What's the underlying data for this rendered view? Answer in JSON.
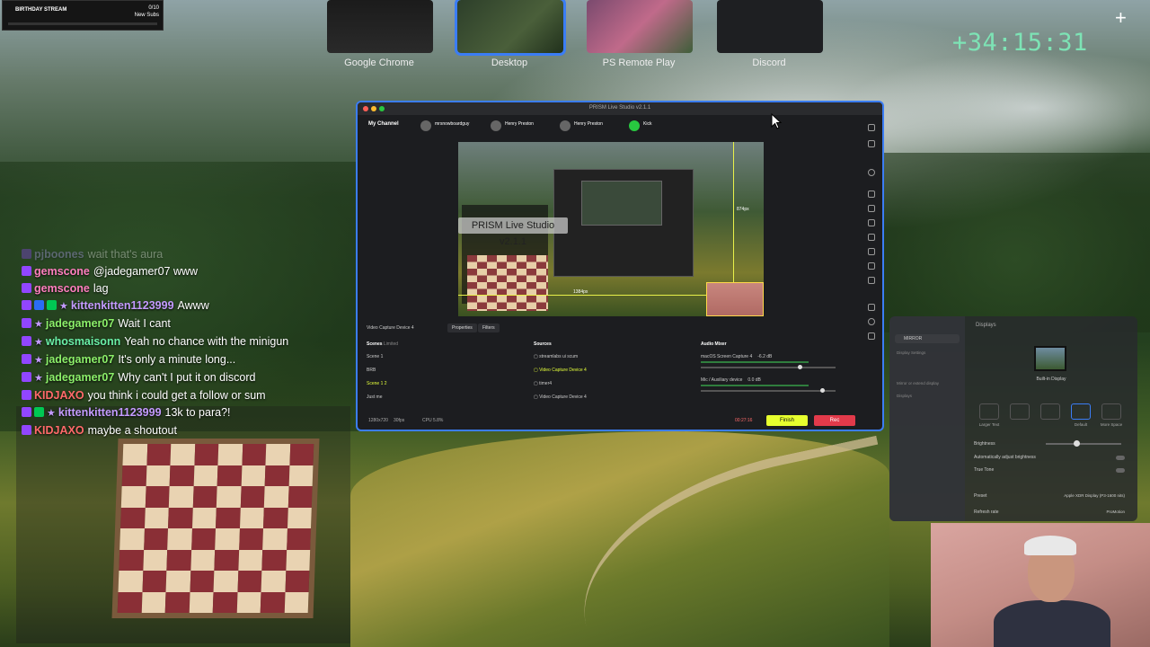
{
  "stream_widget": {
    "title": "BIRTHDAY STREAM",
    "count": "0/10",
    "subtitle": "New Subs"
  },
  "spaces": [
    {
      "label": "Google Chrome",
      "active": false
    },
    {
      "label": "Desktop",
      "active": true
    },
    {
      "label": "PS Remote Play",
      "active": false
    },
    {
      "label": "Discord",
      "active": false
    }
  ],
  "add_space_icon": "plus-icon",
  "timer": "+34:15:31",
  "chat": {
    "messages": [
      {
        "user": "pjboones",
        "text": "wait that's aura",
        "user_color": "#b9a4ff",
        "faded": true,
        "badges": [
          "purple"
        ]
      },
      {
        "user": "gemscone",
        "text": "@jadegamer07 www",
        "user_color": "#ff7fbf",
        "badges": [
          "purple"
        ]
      },
      {
        "user": "gemscone",
        "text": "lag",
        "user_color": "#ff7fbf",
        "badges": [
          "purple"
        ]
      },
      {
        "user": "kittenkitten1123999",
        "text": "Awww",
        "user_color": "#c49bff",
        "badges": [
          "purple",
          "blue",
          "green",
          "star"
        ]
      },
      {
        "user": "jadegamer07",
        "text": "Wait I cant",
        "user_color": "#8cf06a",
        "badges": [
          "purple",
          "star"
        ]
      },
      {
        "user": "whosmaisonn",
        "text": "Yeah no chance with the minigun",
        "user_color": "#6af0a8",
        "badges": [
          "purple",
          "star"
        ]
      },
      {
        "user": "jadegamer07",
        "text": "It's only a minute long...",
        "user_color": "#8cf06a",
        "badges": [
          "purple",
          "star"
        ]
      },
      {
        "user": "jadegamer07",
        "text": "Why can't I put it on discord",
        "user_color": "#8cf06a",
        "badges": [
          "purple",
          "star"
        ]
      },
      {
        "user": "KIDJAXO",
        "text": "you think i could get a follow or sum",
        "user_color": "#ff6a6a",
        "badges": [
          "purple"
        ]
      },
      {
        "user": "kittenkitten1123999",
        "text": "13k to para?!",
        "user_color": "#c49bff",
        "badges": [
          "purple",
          "green",
          "star"
        ]
      },
      {
        "user": "KIDJAXO",
        "text": "maybe a shoutout",
        "user_color": "#ff6a6a",
        "badges": [
          "purple"
        ]
      }
    ]
  },
  "prism": {
    "window_title": "PRISM Live Studio v2.1.1",
    "my_channel": "My Channel",
    "accounts": [
      {
        "name": "mrsnowboardguy"
      },
      {
        "name": "Henry Preston"
      },
      {
        "name": "Henry Preston"
      },
      {
        "name": "Kick"
      }
    ],
    "banner": "PRISM Live Studio v2.1.1",
    "preview_labels": {
      "width_px": "1384px",
      "height_px": "874px"
    },
    "source_label": "Video Capture Device 4",
    "tabs": [
      "Properties",
      "Filters"
    ],
    "scenes": {
      "title": "Scenes",
      "limit": "Limited",
      "items": [
        "Scene 1",
        "BRB",
        "Scene 1 2",
        "Just me"
      ],
      "selected": 2
    },
    "sources": {
      "title": "Sources",
      "items": [
        "streamlabs ui scum",
        "Video Capture Device 4",
        "timer4",
        "Video Capture Device 4"
      ],
      "selected": 1
    },
    "audio_mixer": {
      "title": "Audio Mixer",
      "channels": [
        {
          "name": "macOS Screen Capture 4",
          "db": "-6.2 dB",
          "level": 0.73
        },
        {
          "name": "Mic / Auxiliary device",
          "db": "0.0 dB",
          "level": 0.9
        }
      ]
    },
    "status": {
      "resolution": "1280x720",
      "fps": "30fps",
      "cpu": "CPU 5.8%",
      "live_time": "00:27:16"
    },
    "finish_label": "Finish",
    "rec_label": "Rec"
  },
  "displays": {
    "title": "Displays",
    "search_value": "MIRROR",
    "sidebar_items": [
      "Display Settings",
      "Mirror or extend display",
      "Displays"
    ],
    "monitor_label": "Built-in Display",
    "resolution_options": [
      "Larger Text",
      "",
      "",
      "Default",
      "More Space"
    ],
    "brightness_label": "Brightness",
    "brightness_level": 0.4,
    "auto_brightness_label": "Automatically adjust brightness",
    "true_tone_label": "True Tone",
    "preset_label": "Preset",
    "preset_value": "Apple XDR Display (P3-1600 nits)",
    "refresh_label": "Refresh rate",
    "refresh_value": "ProMotion"
  }
}
